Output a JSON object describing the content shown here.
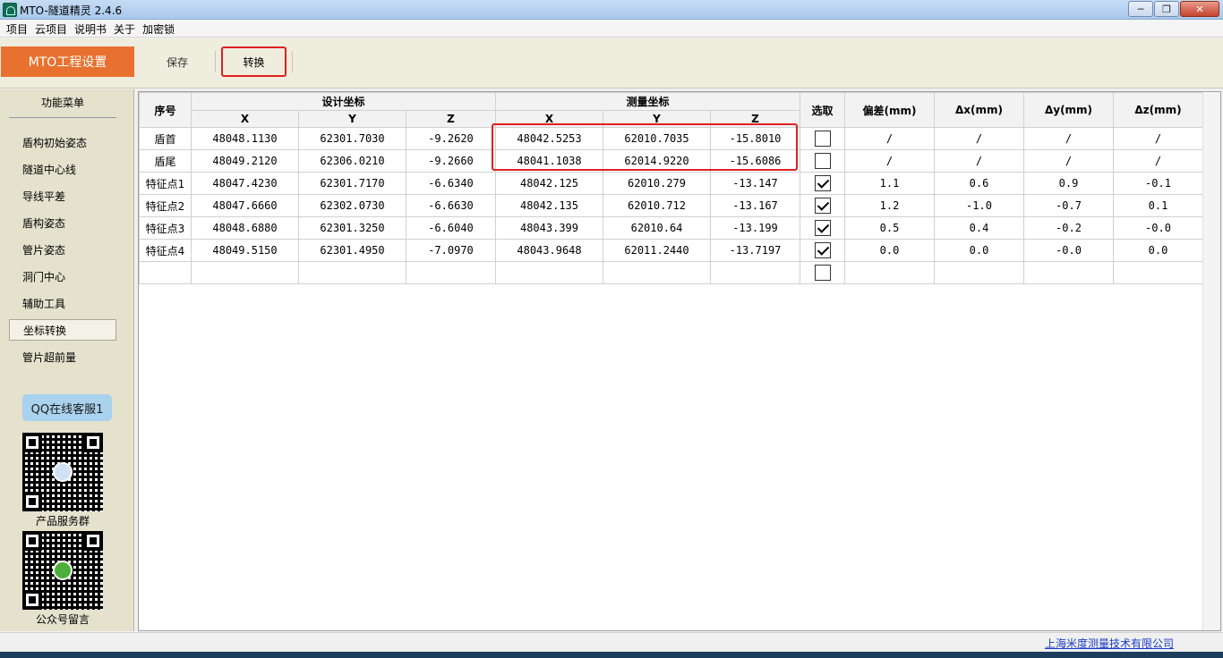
{
  "window": {
    "title": "MTO-隧道精灵 2.4.6"
  },
  "menu": [
    "项目",
    "云项目",
    "说明书",
    "关于",
    "加密锁"
  ],
  "toolbar": {
    "main_label": "MTO工程设置",
    "save_label": "保存",
    "convert_label": "转换"
  },
  "sidebar": {
    "header": "功能菜单",
    "items": [
      {
        "label": "盾构初始姿态",
        "active": false
      },
      {
        "label": "隧道中心线",
        "active": false
      },
      {
        "label": "导线平差",
        "active": false
      },
      {
        "label": "盾构姿态",
        "active": false
      },
      {
        "label": "管片姿态",
        "active": false
      },
      {
        "label": "洞门中心",
        "active": false
      },
      {
        "label": "辅助工具",
        "active": false
      },
      {
        "label": "坐标转换",
        "active": true
      },
      {
        "label": "管片超前量",
        "active": false
      }
    ],
    "qq_button": "QQ在线客服1",
    "qr1_label": "产品服务群",
    "qr2_label": "公众号留言"
  },
  "table": {
    "headers": {
      "index": "序号",
      "design": "设计坐标",
      "measured": "测量坐标",
      "select": "选取",
      "deviation": "偏差(mm)",
      "dx": "Δx(mm)",
      "dy": "Δy(mm)",
      "dz": "Δz(mm)",
      "x": "X",
      "y": "Y",
      "z": "Z"
    },
    "rows": [
      {
        "name": "盾首",
        "dX": "48048.1130",
        "dY": "62301.7030",
        "dZ": "-9.2620",
        "mX": "48042.5253",
        "mY": "62010.7035",
        "mZ": "-15.8010",
        "checked": false,
        "dev": "/",
        "ddx": "/",
        "ddy": "/",
        "ddz": "/"
      },
      {
        "name": "盾尾",
        "dX": "48049.2120",
        "dY": "62306.0210",
        "dZ": "-9.2660",
        "mX": "48041.1038",
        "mY": "62014.9220",
        "mZ": "-15.6086",
        "checked": false,
        "dev": "/",
        "ddx": "/",
        "ddy": "/",
        "ddz": "/"
      },
      {
        "name": "特征点1",
        "dX": "48047.4230",
        "dY": "62301.7170",
        "dZ": "-6.6340",
        "mX": "48042.125",
        "mY": "62010.279",
        "mZ": "-13.147",
        "checked": true,
        "dev": "1.1",
        "ddx": "0.6",
        "ddy": "0.9",
        "ddz": "-0.1"
      },
      {
        "name": "特征点2",
        "dX": "48047.6660",
        "dY": "62302.0730",
        "dZ": "-6.6630",
        "mX": "48042.135",
        "mY": "62010.712",
        "mZ": "-13.167",
        "checked": true,
        "dev": "1.2",
        "ddx": "-1.0",
        "ddy": "-0.7",
        "ddz": "0.1"
      },
      {
        "name": "特征点3",
        "dX": "48048.6880",
        "dY": "62301.3250",
        "dZ": "-6.6040",
        "mX": "48043.399",
        "mY": "62010.64",
        "mZ": "-13.199",
        "checked": true,
        "dev": "0.5",
        "ddx": "0.4",
        "ddy": "-0.2",
        "ddz": "-0.0"
      },
      {
        "name": "特征点4",
        "dX": "48049.5150",
        "dY": "62301.4950",
        "dZ": "-7.0970",
        "mX": "48043.9648",
        "mY": "62011.2440",
        "mZ": "-13.7197",
        "checked": true,
        "dev": "0.0",
        "ddx": "0.0",
        "ddy": "-0.0",
        "ddz": "0.0"
      },
      {
        "name": "",
        "dX": "",
        "dY": "",
        "dZ": "",
        "mX": "",
        "mY": "",
        "mZ": "",
        "checked": false,
        "dev": "",
        "ddx": "",
        "ddy": "",
        "ddz": ""
      }
    ]
  },
  "status": {
    "company": "上海米度测量技术有限公司"
  }
}
